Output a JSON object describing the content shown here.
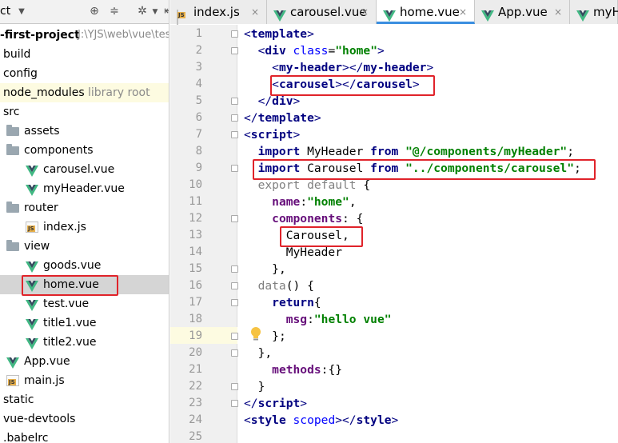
{
  "panel": {
    "title_fragment": "ct",
    "tree": [
      {
        "label": "-first-project",
        "path": "J:\\YJS\\web\\vue\\test"
      },
      {
        "label": "build"
      },
      {
        "label": "config"
      },
      {
        "label": "node_modules",
        "note": "library root"
      },
      {
        "label": "src"
      },
      {
        "label": "assets"
      },
      {
        "label": "components"
      },
      {
        "label": "carousel.vue"
      },
      {
        "label": "myHeader.vue"
      },
      {
        "label": "router"
      },
      {
        "label": "index.js"
      },
      {
        "label": "view"
      },
      {
        "label": "goods.vue"
      },
      {
        "label": "home.vue"
      },
      {
        "label": "test.vue"
      },
      {
        "label": "title1.vue"
      },
      {
        "label": "title2.vue"
      },
      {
        "label": "App.vue"
      },
      {
        "label": "main.js"
      },
      {
        "label": "static"
      },
      {
        "label": "vue-devtools"
      },
      {
        "label": ".babelrc"
      }
    ]
  },
  "tabs": [
    {
      "label": "index.js",
      "icon": "js-file-icon"
    },
    {
      "label": "carousel.vue",
      "icon": "vue-icon"
    },
    {
      "label": "home.vue",
      "icon": "vue-icon",
      "active": true
    },
    {
      "label": "App.vue",
      "icon": "vue-icon"
    },
    {
      "label": "myHe",
      "icon": "vue-icon"
    }
  ],
  "editor": {
    "line_numbers": [
      "1",
      "2",
      "3",
      "4",
      "5",
      "6",
      "7",
      "8",
      "9",
      "10",
      "11",
      "12",
      "13",
      "14",
      "15",
      "16",
      "17",
      "18",
      "19",
      "20",
      "21",
      "22",
      "23",
      "24",
      "25"
    ],
    "lines": [
      [
        {
          "t": "<",
          "c": "tag-br"
        },
        {
          "t": "template",
          "c": "tag"
        },
        {
          "t": ">",
          "c": "tag-br"
        }
      ],
      [
        {
          "t": "  "
        },
        {
          "t": "<",
          "c": "tag-br"
        },
        {
          "t": "div ",
          "c": "tag"
        },
        {
          "t": "class",
          "c": "attr"
        },
        {
          "t": "=",
          "c": "plain"
        },
        {
          "t": "\"home\"",
          "c": "str"
        },
        {
          "t": ">",
          "c": "tag-br"
        }
      ],
      [
        {
          "t": "    "
        },
        {
          "t": "<",
          "c": "tag-br"
        },
        {
          "t": "my-header",
          "c": "tag"
        },
        {
          "t": "></",
          "c": "tag-br"
        },
        {
          "t": "my-header",
          "c": "tag"
        },
        {
          "t": ">",
          "c": "tag-br"
        }
      ],
      [
        {
          "t": "    "
        },
        {
          "t": "<",
          "c": "tag-br"
        },
        {
          "t": "carousel",
          "c": "tag"
        },
        {
          "t": "></",
          "c": "tag-br"
        },
        {
          "t": "carousel",
          "c": "tag"
        },
        {
          "t": ">",
          "c": "tag-br"
        }
      ],
      [
        {
          "t": "  "
        },
        {
          "t": "</",
          "c": "tag-br"
        },
        {
          "t": "div",
          "c": "tag"
        },
        {
          "t": ">",
          "c": "tag-br"
        }
      ],
      [
        {
          "t": "</",
          "c": "tag-br"
        },
        {
          "t": "template",
          "c": "tag"
        },
        {
          "t": ">",
          "c": "tag-br"
        }
      ],
      [
        {
          "t": "<",
          "c": "tag-br"
        },
        {
          "t": "script",
          "c": "tag"
        },
        {
          "t": ">",
          "c": "tag-br"
        }
      ],
      [
        {
          "t": "  "
        },
        {
          "t": "import ",
          "c": "kw"
        },
        {
          "t": "MyHeader ",
          "c": "plain"
        },
        {
          "t": "from ",
          "c": "kw"
        },
        {
          "t": "\"@/components/myHeader\"",
          "c": "str"
        },
        {
          "t": ";",
          "c": "plain"
        }
      ],
      [
        {
          "t": "  "
        },
        {
          "t": "import ",
          "c": "kw"
        },
        {
          "t": "Carousel ",
          "c": "plain"
        },
        {
          "t": "from ",
          "c": "kw"
        },
        {
          "t": "\"../components/carousel\"",
          "c": "str"
        },
        {
          "t": ";",
          "c": "plain"
        }
      ],
      [
        {
          "t": "  "
        },
        {
          "t": "export default ",
          "c": "kw2"
        },
        {
          "t": "{",
          "c": "plain"
        }
      ],
      [
        {
          "t": "    "
        },
        {
          "t": "name",
          "c": "prop"
        },
        {
          "t": ":",
          "c": "plain"
        },
        {
          "t": "\"home\"",
          "c": "str"
        },
        {
          "t": ",",
          "c": "plain"
        }
      ],
      [
        {
          "t": "    "
        },
        {
          "t": "components",
          "c": "prop"
        },
        {
          "t": ": {",
          "c": "plain"
        }
      ],
      [
        {
          "t": "      "
        },
        {
          "t": "Carousel,",
          "c": "plain"
        }
      ],
      [
        {
          "t": "      "
        },
        {
          "t": "MyHeader",
          "c": "plain"
        }
      ],
      [
        {
          "t": "    "
        },
        {
          "t": "},",
          "c": "plain"
        }
      ],
      [
        {
          "t": "  "
        },
        {
          "t": "data",
          "c": "kw2"
        },
        {
          "t": "() {",
          "c": "plain"
        }
      ],
      [
        {
          "t": "    "
        },
        {
          "t": "return",
          "c": "kw"
        },
        {
          "t": "{",
          "c": "plain"
        }
      ],
      [
        {
          "t": "      "
        },
        {
          "t": "msg",
          "c": "prop"
        },
        {
          "t": ":",
          "c": "plain"
        },
        {
          "t": "\"hello vue\"",
          "c": "str"
        }
      ],
      [
        {
          "t": "    "
        },
        {
          "t": "};",
          "c": "plain"
        }
      ],
      [
        {
          "t": "  "
        },
        {
          "t": "},",
          "c": "plain"
        }
      ],
      [
        {
          "t": "    "
        },
        {
          "t": "methods",
          "c": "prop"
        },
        {
          "t": ":{}",
          "c": "plain"
        }
      ],
      [
        {
          "t": "  "
        },
        {
          "t": "}",
          "c": "plain"
        }
      ],
      [
        {
          "t": "</",
          "c": "tag-br"
        },
        {
          "t": "script",
          "c": "tag"
        },
        {
          "t": ">",
          "c": "tag-br"
        }
      ],
      [
        {
          "t": "<",
          "c": "tag-br"
        },
        {
          "t": "style ",
          "c": "tag"
        },
        {
          "t": "scoped",
          "c": "attr"
        },
        {
          "t": "></",
          "c": "tag-br"
        },
        {
          "t": "style",
          "c": "tag"
        },
        {
          "t": ">",
          "c": "tag-br"
        }
      ],
      []
    ]
  },
  "colors": {
    "highlight_box": "#e0232a",
    "vue_green": "#41b883",
    "vue_dark": "#35495e",
    "active_tab_underline": "#3b8fe0"
  }
}
